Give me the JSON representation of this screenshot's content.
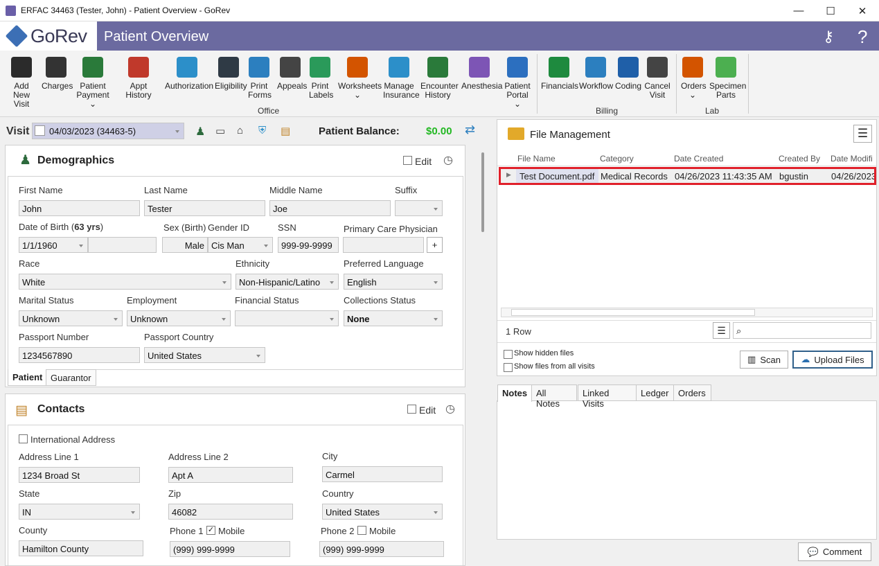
{
  "window": {
    "title": "ERFAC 34463 (Tester, John) - Patient Overview - GoRev",
    "minimize": "—",
    "maximize": "☐",
    "close": "✕"
  },
  "app": {
    "logo": "GoRev",
    "page_title": "Patient Overview"
  },
  "ribbon": {
    "office": [
      {
        "label": "Add New Visit",
        "icon": "bed-add-icon",
        "color": "#2b2b2b"
      },
      {
        "label": "Charges",
        "icon": "barcode-icon",
        "color": "#333333"
      },
      {
        "label": "Patient Payment ⌄",
        "icon": "patient-payment-icon",
        "color": "#2a7a3a"
      },
      {
        "label": "Appt History",
        "icon": "calendar-icon",
        "color": "#c0392b"
      },
      {
        "label": "Authorization",
        "icon": "shield-check-icon",
        "color": "#2c8fc9"
      },
      {
        "label": "Eligibility",
        "icon": "user-check-icon",
        "color": "#2f3a45"
      },
      {
        "label": "Print Forms",
        "icon": "printer-icon",
        "color": "#2c7fbf"
      },
      {
        "label": "Appeals",
        "icon": "briefcase-icon",
        "color": "#444444"
      },
      {
        "label": "Print Labels",
        "icon": "tag-icon",
        "color": "#2a9a5a"
      },
      {
        "label": "Worksheets ⌄",
        "icon": "worksheet-icon",
        "color": "#d35400"
      },
      {
        "label": "Manage Insurance",
        "icon": "insurance-icon",
        "color": "#2c8fc9"
      },
      {
        "label": "Encounter History",
        "icon": "encounter-history-icon",
        "color": "#2a7a3a"
      },
      {
        "label": "Anesthesia",
        "icon": "syringe-icon",
        "color": "#7d55b5"
      },
      {
        "label": "Patient Portal ⌄",
        "icon": "globe-gear-icon",
        "color": "#2c6fbf"
      }
    ],
    "billing": [
      {
        "label": "Financials",
        "icon": "dollar-icon",
        "color": "#1e8a3e"
      },
      {
        "label": "Workflow",
        "icon": "workflow-icon",
        "color": "#2c7fbf"
      },
      {
        "label": "Coding",
        "icon": "book-plus-icon",
        "color": "#1f5fa8"
      },
      {
        "label": "Cancel Visit",
        "icon": "cancel-clock-icon",
        "color": "#444444"
      }
    ],
    "lab": [
      {
        "label": "Orders ⌄",
        "icon": "orders-icon",
        "color": "#d35400"
      },
      {
        "label": "Specimen Parts",
        "icon": "specimen-icon",
        "color": "#4caf50"
      }
    ],
    "groups": {
      "office": "Office",
      "billing": "Billing",
      "lab": "Lab"
    }
  },
  "visit": {
    "label": "Visit",
    "value": "04/03/2023 (34463-5)",
    "balance_label": "Patient Balance:",
    "balance": "$0.00",
    "balance_color": "#22b822"
  },
  "demographics": {
    "title": "Demographics",
    "edit": "Edit",
    "first_name_label": "First Name",
    "first_name": "John",
    "last_name_label": "Last Name",
    "last_name": "Tester",
    "middle_name_label": "Middle Name",
    "middle_name": "Joe",
    "suffix_label": "Suffix",
    "suffix": "",
    "dob_label": "Date of Birth (",
    "dob_age": "63 yrs",
    "dob_label_end": ")",
    "dob": "1/1/1960",
    "sex_label": "Sex (Birth)",
    "sex": "Male",
    "gender_label": "Gender ID",
    "gender": "Cis Man",
    "ssn_label": "SSN",
    "ssn": "999-99-9999",
    "pcp_label": "Primary Care Physician",
    "pcp": "",
    "pcp_add": "+",
    "race_label": "Race",
    "race": "White",
    "ethnicity_label": "Ethnicity",
    "ethnicity": "Non-Hispanic/Latino",
    "language_label": "Preferred Language",
    "language": "English",
    "marital_label": "Marital Status",
    "marital": "Unknown",
    "employment_label": "Employment",
    "employment": "Unknown",
    "financial_label": "Financial Status",
    "financial": "",
    "collections_label": "Collections Status",
    "collections": "None",
    "passport_label": "Passport Number",
    "passport": "1234567890",
    "passport_country_label": "Passport Country",
    "passport_country": "United States",
    "tabs": [
      "Patient",
      "Guarantor"
    ]
  },
  "contacts": {
    "title": "Contacts",
    "edit": "Edit",
    "intl": "International Address",
    "addr1_label": "Address Line 1",
    "addr1": "1234 Broad St",
    "addr2_label": "Address Line 2",
    "addr2": "Apt A",
    "city_label": "City",
    "city": "Carmel",
    "state_label": "State",
    "state": "IN",
    "zip_label": "Zip",
    "zip": "46082",
    "country_label": "Country",
    "country": "United States",
    "county_label": "County",
    "county": "Hamilton County",
    "phone1_label": "Phone 1",
    "phone1_mobile": "Mobile",
    "phone1": "(999) 999-9999",
    "phone2_label": "Phone 2",
    "phone2_mobile": "Mobile",
    "phone2": "(999) 999-9999"
  },
  "files": {
    "title": "File Management",
    "columns": [
      "File Name",
      "Category",
      "Date Created",
      "Created By",
      "Date Modifi"
    ],
    "rows": [
      [
        "Test Document.pdf",
        "Medical Records",
        "04/26/2023 11:43:35 AM",
        "bgustin",
        "04/26/2023"
      ]
    ],
    "row_count": "1 Row",
    "show_hidden": "Show hidden files",
    "show_all": "Show files from all visits",
    "scan": "Scan",
    "upload": "Upload Files"
  },
  "notes": {
    "tabs": [
      "Notes",
      "All Notes",
      "Linked Visits",
      "Ledger",
      "Orders"
    ],
    "comment": "Comment"
  }
}
